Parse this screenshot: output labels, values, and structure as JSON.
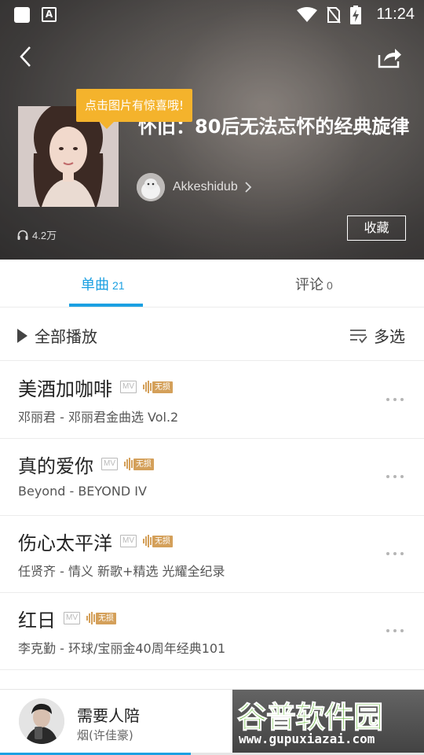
{
  "status_bar": {
    "time": "11:24",
    "icons": [
      "square-notification-icon",
      "a-notification-icon",
      "wifi-icon",
      "no-sim-icon",
      "battery-charging-icon"
    ]
  },
  "header": {
    "back_icon": "back-arrow-icon",
    "share_icon": "share-icon",
    "tooltip": "点击图片有惊喜哦!",
    "playlist_title": "怀旧：80后无法忘怀的经典旋律",
    "creator_name": "Akkeshidub",
    "play_count": "4.2万",
    "collect_label": "收藏"
  },
  "tabs": [
    {
      "label": "单曲",
      "count": "21",
      "active": true
    },
    {
      "label": "评论",
      "count": "0",
      "active": false
    }
  ],
  "toolbar": {
    "play_all": "全部播放",
    "multi_select": "多选"
  },
  "badges": {
    "mv": "MV",
    "lossless": "无损"
  },
  "songs": [
    {
      "title": "美酒加咖啡",
      "subtitle": "邓丽君 - 邓丽君金曲选 Vol.2"
    },
    {
      "title": "真的爱你",
      "subtitle": "Beyond - BEYOND IV"
    },
    {
      "title": "伤心太平洋",
      "subtitle": "任贤齐 - 情义 新歌+精选 光耀全纪录"
    },
    {
      "title": "红日",
      "subtitle": "李克勤 - 环球/宝丽金40周年经典101"
    }
  ],
  "player": {
    "title": "需要人陪",
    "artist": "烟(许佳豪)",
    "progress": 0.45
  },
  "watermark": {
    "text": "谷普软件园",
    "url": "www.gupuxiazai.com"
  },
  "colors": {
    "accent": "#1ba0e2",
    "tooltip": "#f4b32c",
    "lossless": "#d4a05a",
    "watermark_green": "#5fb82f"
  }
}
